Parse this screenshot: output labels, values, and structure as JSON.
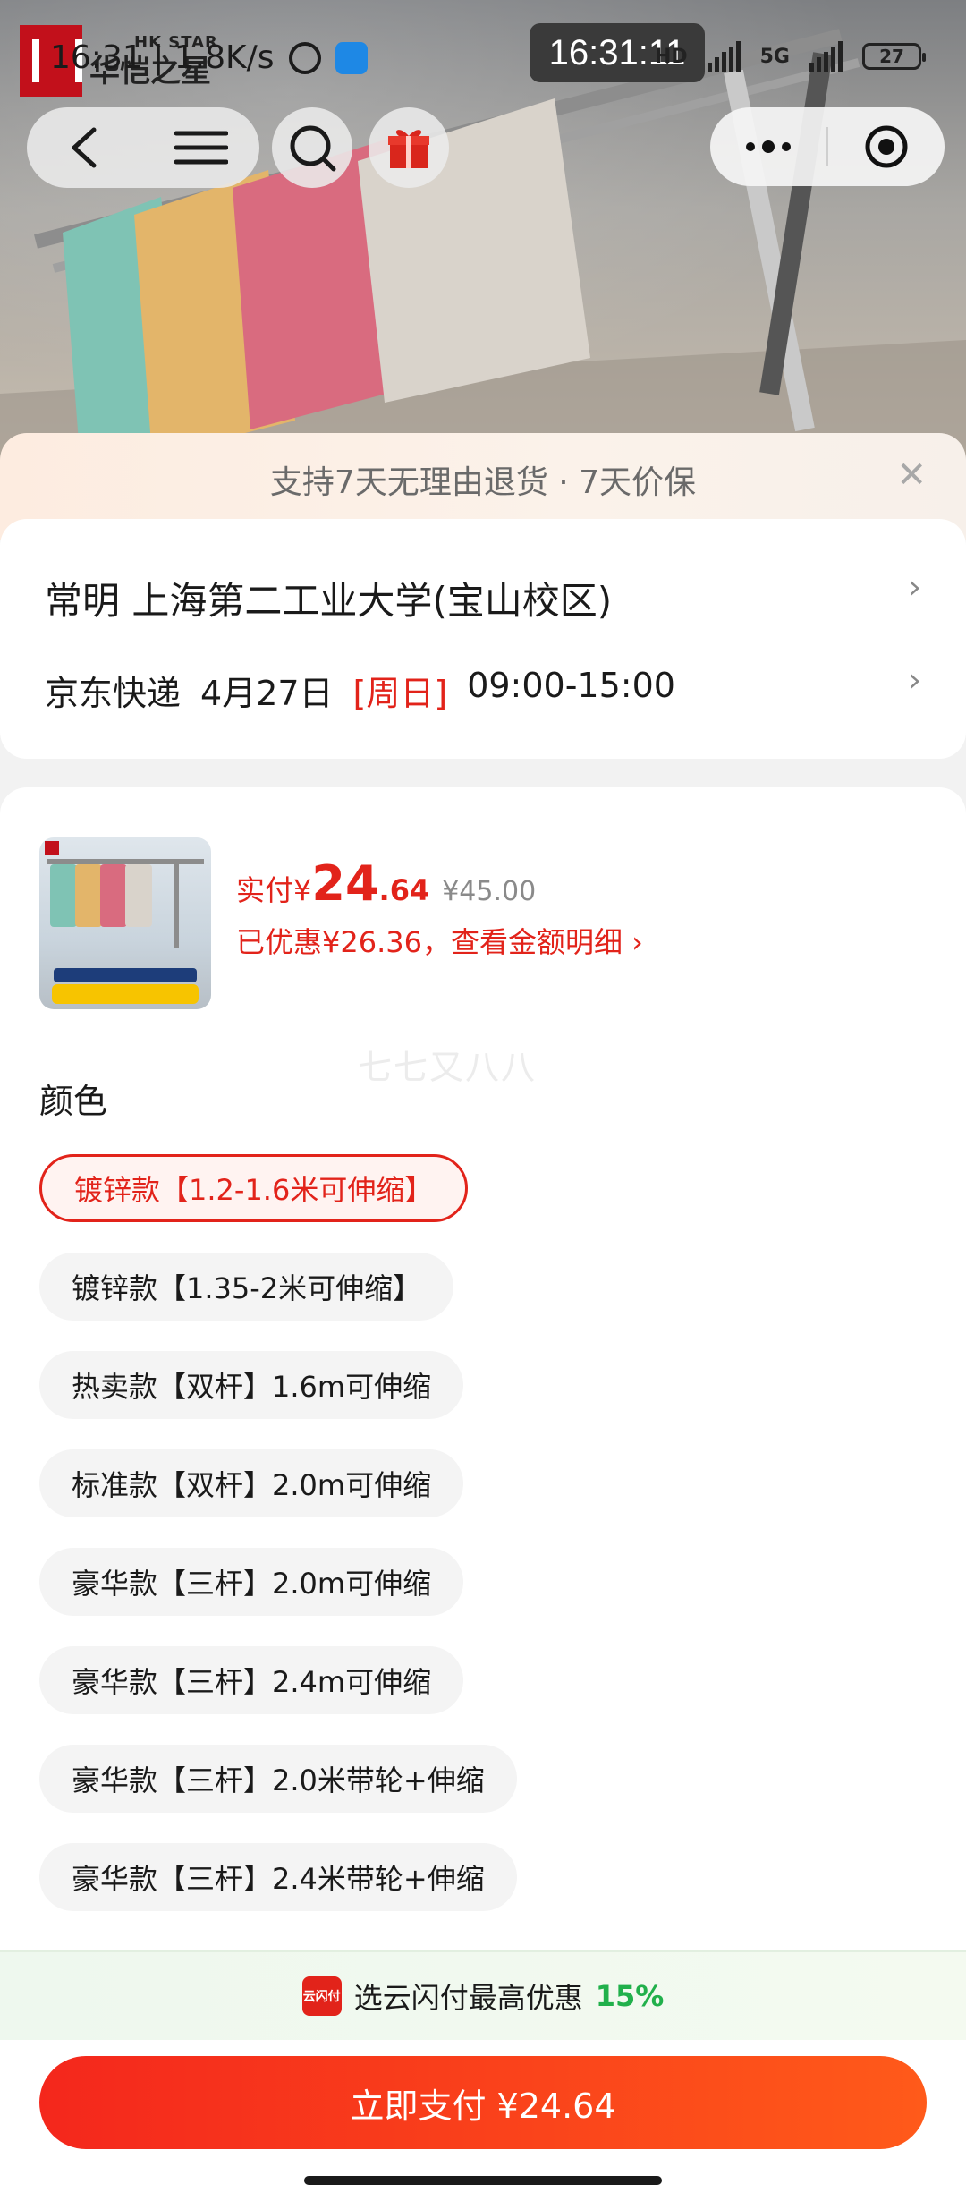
{
  "status_bar": {
    "left_text": "16:31 | 1.8K/s",
    "clock": "16:31:11",
    "network_hd": "HD",
    "network_5g": "5G",
    "battery": "27"
  },
  "brand": {
    "en": "HK STAR",
    "cn": "华恺之星"
  },
  "nav": {
    "back_icon": "back-arrow-icon",
    "menu_icon": "hamburger-icon",
    "search_icon": "search-icon",
    "gift_icon": "gift-icon",
    "more_icon": "more-dots-icon",
    "target_icon": "target-icon"
  },
  "promise": {
    "text": "支持7天无理由退货 · 7天价保",
    "close": "✕"
  },
  "address": {
    "location": "常明  上海第二工业大学(宝山校区)",
    "carrier": "京东快递",
    "date": "4月27日",
    "day": "[周日]",
    "time": "09:00-15:00",
    "arrow": "›"
  },
  "product": {
    "price_prefix": "实付¥",
    "price_int": "24",
    "price_dec": ".64",
    "price_orig": "¥45.00",
    "saving": "已优惠¥26.36，查看金额明细 ›",
    "watermark": "七七又八八"
  },
  "color_section": {
    "label": "颜色",
    "options": [
      {
        "label": "镀锌款【1.2-1.6米可伸缩】",
        "selected": true
      },
      {
        "label": "镀锌款【1.35-2米可伸缩】",
        "selected": false
      },
      {
        "label": "热卖款【双杆】1.6m可伸缩",
        "selected": false
      },
      {
        "label": "标准款【双杆】2.0m可伸缩",
        "selected": false
      },
      {
        "label": "豪华款【三杆】2.0m可伸缩",
        "selected": false
      },
      {
        "label": "豪华款【三杆】2.4m可伸缩",
        "selected": false
      },
      {
        "label": "豪华款【三杆】2.0米带轮+伸缩",
        "selected": false
      },
      {
        "label": "豪华款【三杆】2.4米带轮+伸缩",
        "selected": false
      }
    ]
  },
  "pay_promo": {
    "icon_text": "云闪付",
    "text": "选云闪付最高优惠",
    "percent": "15%"
  },
  "pay_button": {
    "label": "立即支付 ¥24.64"
  },
  "colors": {
    "accent_red": "#e2231a",
    "promo_green": "#21b04b"
  }
}
